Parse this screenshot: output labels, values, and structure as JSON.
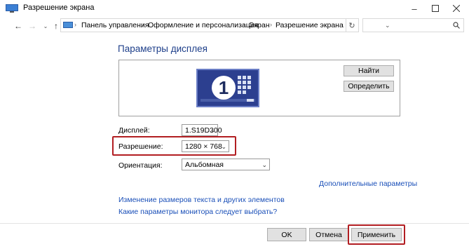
{
  "window": {
    "title": "Разрешение экрана"
  },
  "nav": {
    "breadcrumbs": [
      "Панель управления",
      "Оформление и персонализация",
      "Экран",
      "Разрешение экрана"
    ],
    "search_placeholder": ""
  },
  "main": {
    "heading": "Параметры дисплея",
    "monitor_number": "1",
    "find_button": "Найти",
    "identify_button": "Определить",
    "display_label": "Дисплей:",
    "display_value": "1.S19D300",
    "resolution_label": "Разрешение:",
    "resolution_value": "1280 × 768",
    "orientation_label": "Ориентация:",
    "orientation_value": "Альбомная",
    "advanced_link": "Дополнительные параметры",
    "link_text_size": "Изменение размеров текста и других элементов",
    "link_monitor_params": "Какие параметры монитора следует выбрать?"
  },
  "footer": {
    "ok": "OK",
    "cancel": "Отмена",
    "apply": "Применить"
  },
  "colors": {
    "accent": "#1e3f8a",
    "link": "#1a4fb8",
    "highlight": "#b21e22",
    "monitor": "#2c3f8f"
  }
}
